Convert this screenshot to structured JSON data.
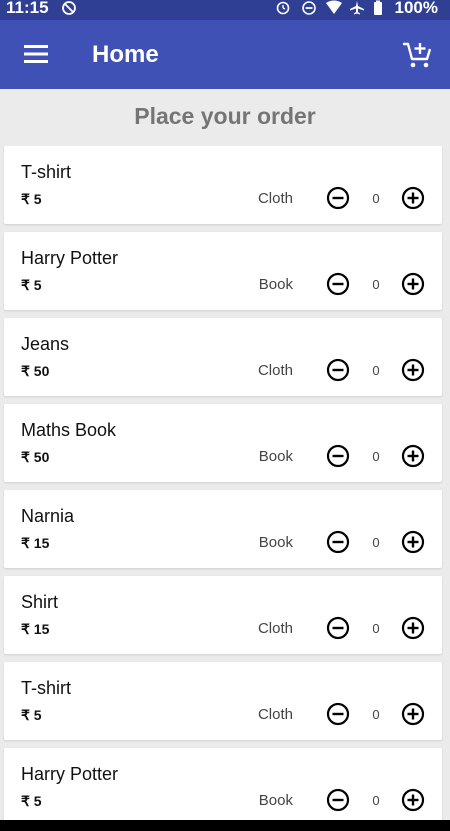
{
  "status_bar": {
    "time": "11:15",
    "battery": "100%",
    "icons": [
      "notification-off-icon",
      "alarm-icon",
      "dnd-icon",
      "wifi-icon",
      "airplane-icon",
      "battery-icon"
    ]
  },
  "app_bar": {
    "title": "Home",
    "menu_icon": "hamburger-menu-icon",
    "cart_icon": "add-to-cart-icon",
    "color": "#3f51b5"
  },
  "heading": "Place your order",
  "products": [
    {
      "name": "T-shirt",
      "price": "₹ 5",
      "category": "Cloth",
      "quantity": "0"
    },
    {
      "name": "Harry Potter",
      "price": "₹ 5",
      "category": "Book",
      "quantity": "0"
    },
    {
      "name": "Jeans",
      "price": "₹ 50",
      "category": "Cloth",
      "quantity": "0"
    },
    {
      "name": "Maths Book",
      "price": "₹ 50",
      "category": "Book",
      "quantity": "0"
    },
    {
      "name": "Narnia",
      "price": "₹ 15",
      "category": "Book",
      "quantity": "0"
    },
    {
      "name": "Shirt",
      "price": "₹ 15",
      "category": "Cloth",
      "quantity": "0"
    },
    {
      "name": "T-shirt",
      "price": "₹ 5",
      "category": "Cloth",
      "quantity": "0"
    },
    {
      "name": "Harry Potter",
      "price": "₹ 5",
      "category": "Book",
      "quantity": "0"
    }
  ]
}
